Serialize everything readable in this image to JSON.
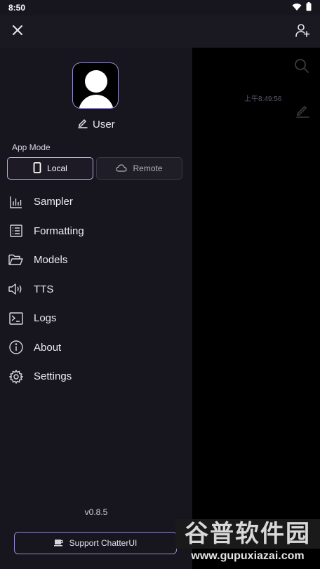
{
  "status": {
    "time": "8:50"
  },
  "drawer": {
    "username": "User",
    "app_mode_label": "App Mode",
    "modes": [
      {
        "label": "Local",
        "icon": "phone-icon",
        "active": true
      },
      {
        "label": "Remote",
        "icon": "cloud-icon",
        "active": false
      }
    ],
    "menu": [
      {
        "label": "Sampler",
        "icon": "bar-chart-icon"
      },
      {
        "label": "Formatting",
        "icon": "list-icon"
      },
      {
        "label": "Models",
        "icon": "folder-icon"
      },
      {
        "label": "TTS",
        "icon": "speaker-icon"
      },
      {
        "label": "Logs",
        "icon": "terminal-icon"
      },
      {
        "label": "About",
        "icon": "info-icon"
      },
      {
        "label": "Settings",
        "icon": "gear-icon"
      }
    ],
    "version": "v0.8.5",
    "support_label": "Support ChatterUI"
  },
  "background": {
    "timestamp": "上午8:49:56"
  },
  "watermark": {
    "title": "谷普软件园",
    "url": "www.gupuxiazai.com"
  },
  "colors": {
    "drawer_bg": "#17151d",
    "accent": "#9b8bd1",
    "background": "#000000"
  }
}
